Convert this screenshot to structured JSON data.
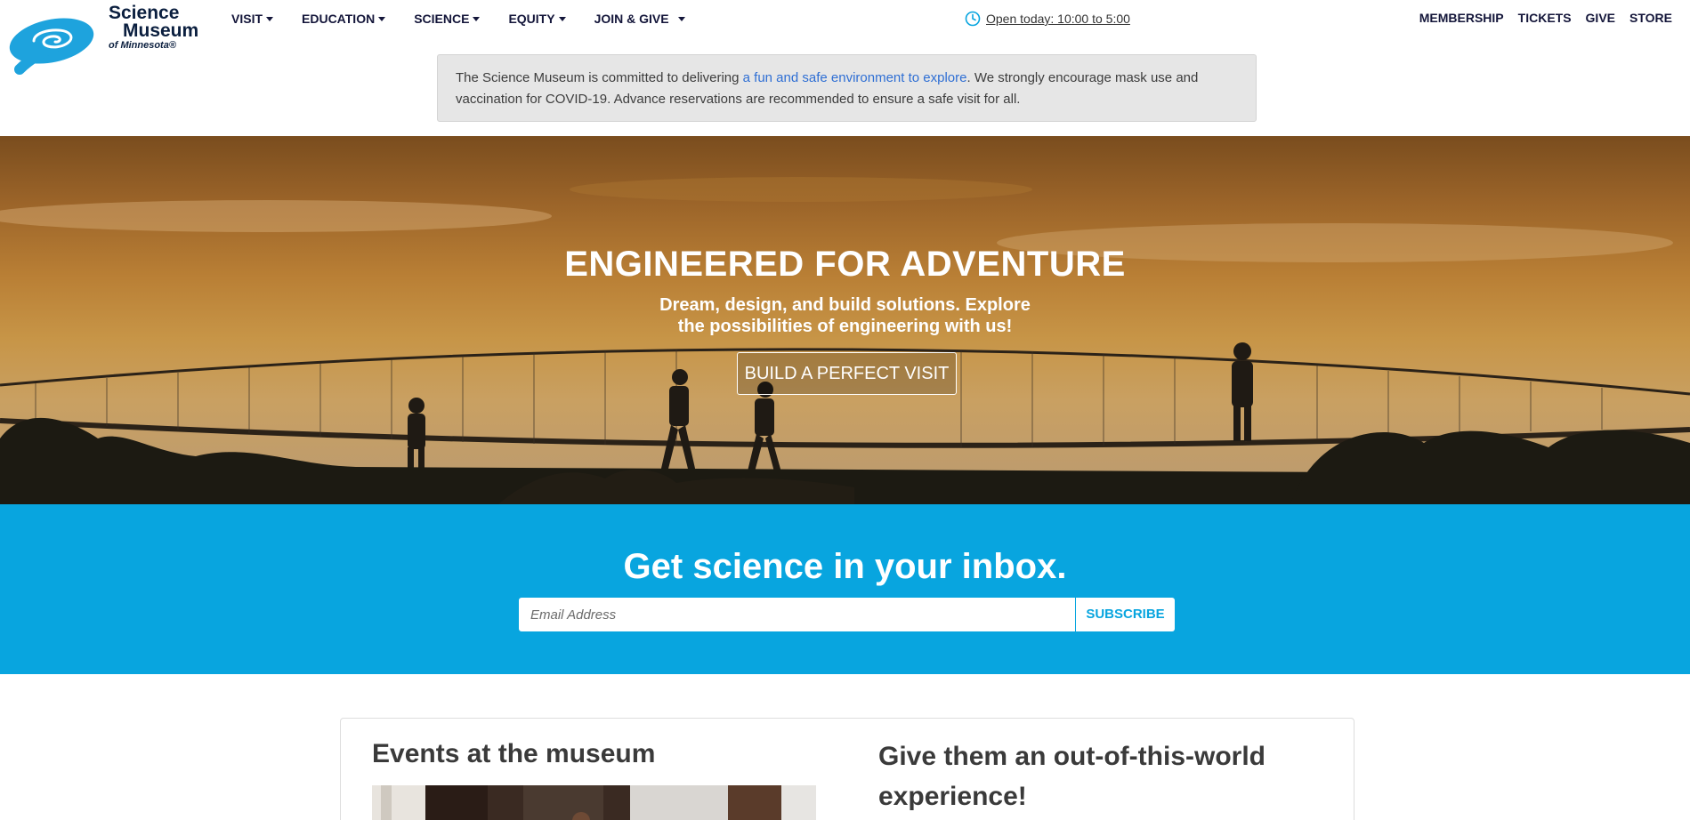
{
  "logo": {
    "line1": "Science",
    "line2": "Museum",
    "line3": "of Minnesota®"
  },
  "main_nav": [
    {
      "label": "VISIT"
    },
    {
      "label": "EDUCATION"
    },
    {
      "label": "SCIENCE"
    },
    {
      "label": "EQUITY"
    },
    {
      "label": "JOIN & GIVE"
    }
  ],
  "hours": {
    "text": "Open today: 10:00 to 5:00",
    "icon": "clock-icon"
  },
  "util_nav": [
    {
      "label": "MEMBERSHIP"
    },
    {
      "label": "TICKETS"
    },
    {
      "label": "GIVE"
    },
    {
      "label": "STORE"
    }
  ],
  "alert": {
    "before": "The Science Museum is committed to delivering ",
    "link": "a fun and safe environment to explore",
    "after": ". We strongly encourage mask use and vaccination for COVID-19. Advance reservations are recommended to ensure a safe visit for all."
  },
  "hero": {
    "title": "ENGINEERED FOR ADVENTURE",
    "subtitle_line1": "Dream, design, and build solutions. Explore",
    "subtitle_line2": "the possibilities of engineering with us!",
    "button": "BUILD A PERFECT VISIT"
  },
  "newsletter": {
    "title": "Get science in your inbox.",
    "placeholder": "Email Address",
    "button": "SUBSCRIBE"
  },
  "sections": {
    "events_title": "Events at the museum",
    "give_title": "Give them an out-of-this-world experience!"
  },
  "colors": {
    "brand_blue": "#08a5df",
    "nav_text": "#14163a",
    "link_blue": "#2f6fd4",
    "alert_bg": "#e6e6e6"
  }
}
